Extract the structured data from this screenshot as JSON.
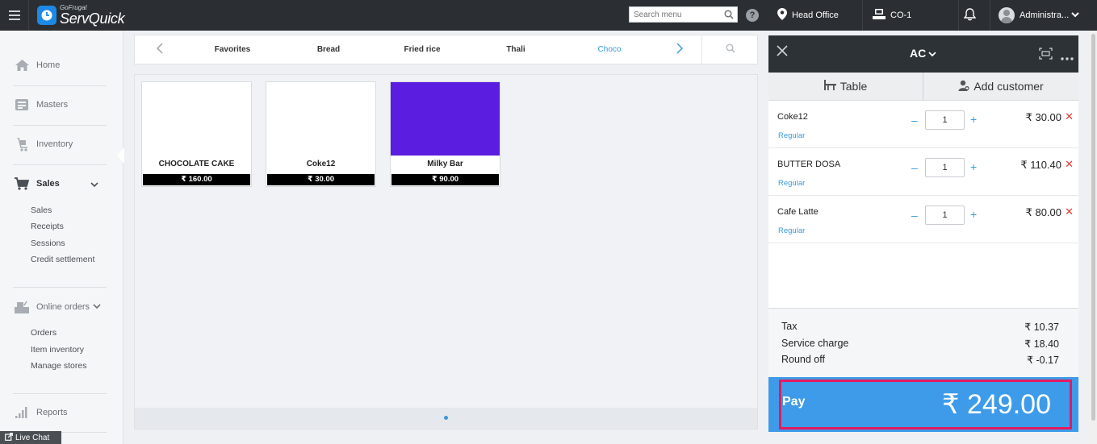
{
  "header": {
    "logo_small": "GoFrugal",
    "logo_big": "ServQuick",
    "search_placeholder": "Search menu",
    "location": "Head Office",
    "counter": "CO-1",
    "user": "Administra..."
  },
  "sidebar": {
    "items": [
      {
        "label": "Home",
        "icon": "home-icon"
      },
      {
        "label": "Masters",
        "icon": "masters-icon"
      },
      {
        "label": "Inventory",
        "icon": "inventory-icon"
      },
      {
        "label": "Sales",
        "icon": "cart-icon"
      },
      {
        "label": "Online orders",
        "icon": "online-orders-icon"
      },
      {
        "label": "Reports",
        "icon": "reports-icon"
      }
    ],
    "sales_sub": [
      "Sales",
      "Receipts",
      "Sessions",
      "Credit settlement"
    ],
    "online_sub": [
      "Orders",
      "Item inventory",
      "Manage stores"
    ],
    "live_chat": "Live Chat"
  },
  "categories": [
    "Favorites",
    "Bread",
    "Fried rice",
    "Thali",
    "Choco"
  ],
  "active_category": "Choco",
  "products": [
    {
      "name": "CHOCOLATE CAKE",
      "price": "₹ 160.00",
      "color": "#ffffff"
    },
    {
      "name": "Coke12",
      "price": "₹ 30.00",
      "color": "#ffffff"
    },
    {
      "name": "Milky Bar",
      "price": "₹ 90.00",
      "color": "#5b1ee0"
    }
  ],
  "order": {
    "type": "AC",
    "tab_table": "Table",
    "tab_customer": "Add customer",
    "items": [
      {
        "name": "Coke12",
        "variant": "Regular",
        "qty": "1",
        "price": "₹ 30.00"
      },
      {
        "name": "BUTTER DOSA",
        "variant": "Regular",
        "qty": "1",
        "price": "₹ 110.40"
      },
      {
        "name": "Cafe Latte",
        "variant": "Regular",
        "qty": "1",
        "price": "₹ 80.00"
      }
    ],
    "totals": [
      {
        "label": "Tax",
        "value": "₹ 10.37"
      },
      {
        "label": "Service charge",
        "value": "₹ 18.40"
      },
      {
        "label": "Round off",
        "value": "₹ -0.17"
      }
    ],
    "pay_label": "Pay",
    "pay_amount": "₹ 249.00"
  },
  "colors": {
    "accent": "#3a9ad9",
    "pay_bg": "#3d9be9",
    "highlight_border": "#e5195e",
    "topbar": "#2b2f33"
  }
}
